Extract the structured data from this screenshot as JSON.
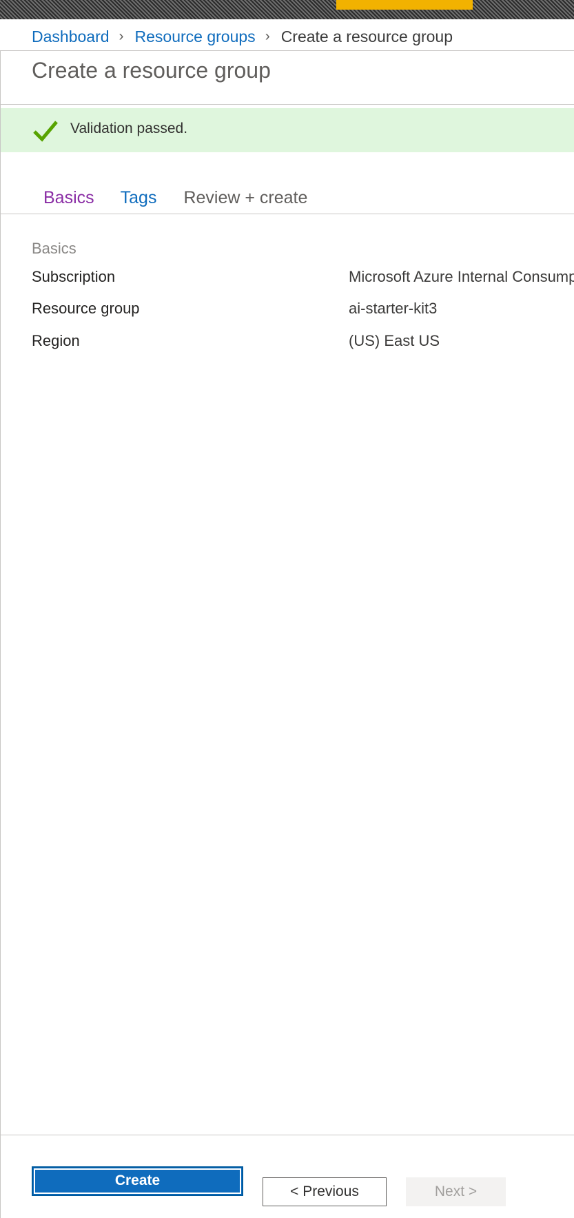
{
  "breadcrumb": {
    "items": [
      {
        "label": "Dashboard"
      },
      {
        "label": "Resource groups"
      },
      {
        "label": "Create a resource group"
      }
    ]
  },
  "page": {
    "title": "Create a resource group"
  },
  "validation": {
    "message": "Validation passed.",
    "icon": "check-icon",
    "color": "#57a300",
    "background": "#dff6dd"
  },
  "tabs": [
    {
      "label": "Basics",
      "state": "visited"
    },
    {
      "label": "Tags",
      "state": "link"
    },
    {
      "label": "Review + create",
      "state": "active"
    }
  ],
  "review": {
    "section_title": "Basics",
    "rows": [
      {
        "label": "Subscription",
        "value": "Microsoft Azure Internal Consump"
      },
      {
        "label": "Resource group",
        "value": "ai-starter-kit3"
      },
      {
        "label": "Region",
        "value": "(US) East US"
      }
    ]
  },
  "footer": {
    "create_label": "Create",
    "previous_label": "< Previous",
    "next_label": "Next >",
    "next_enabled": false
  },
  "colors": {
    "accent": "#0f6cbd",
    "visited_link": "#8a2da5",
    "topbar_badge": "#f2b200"
  }
}
